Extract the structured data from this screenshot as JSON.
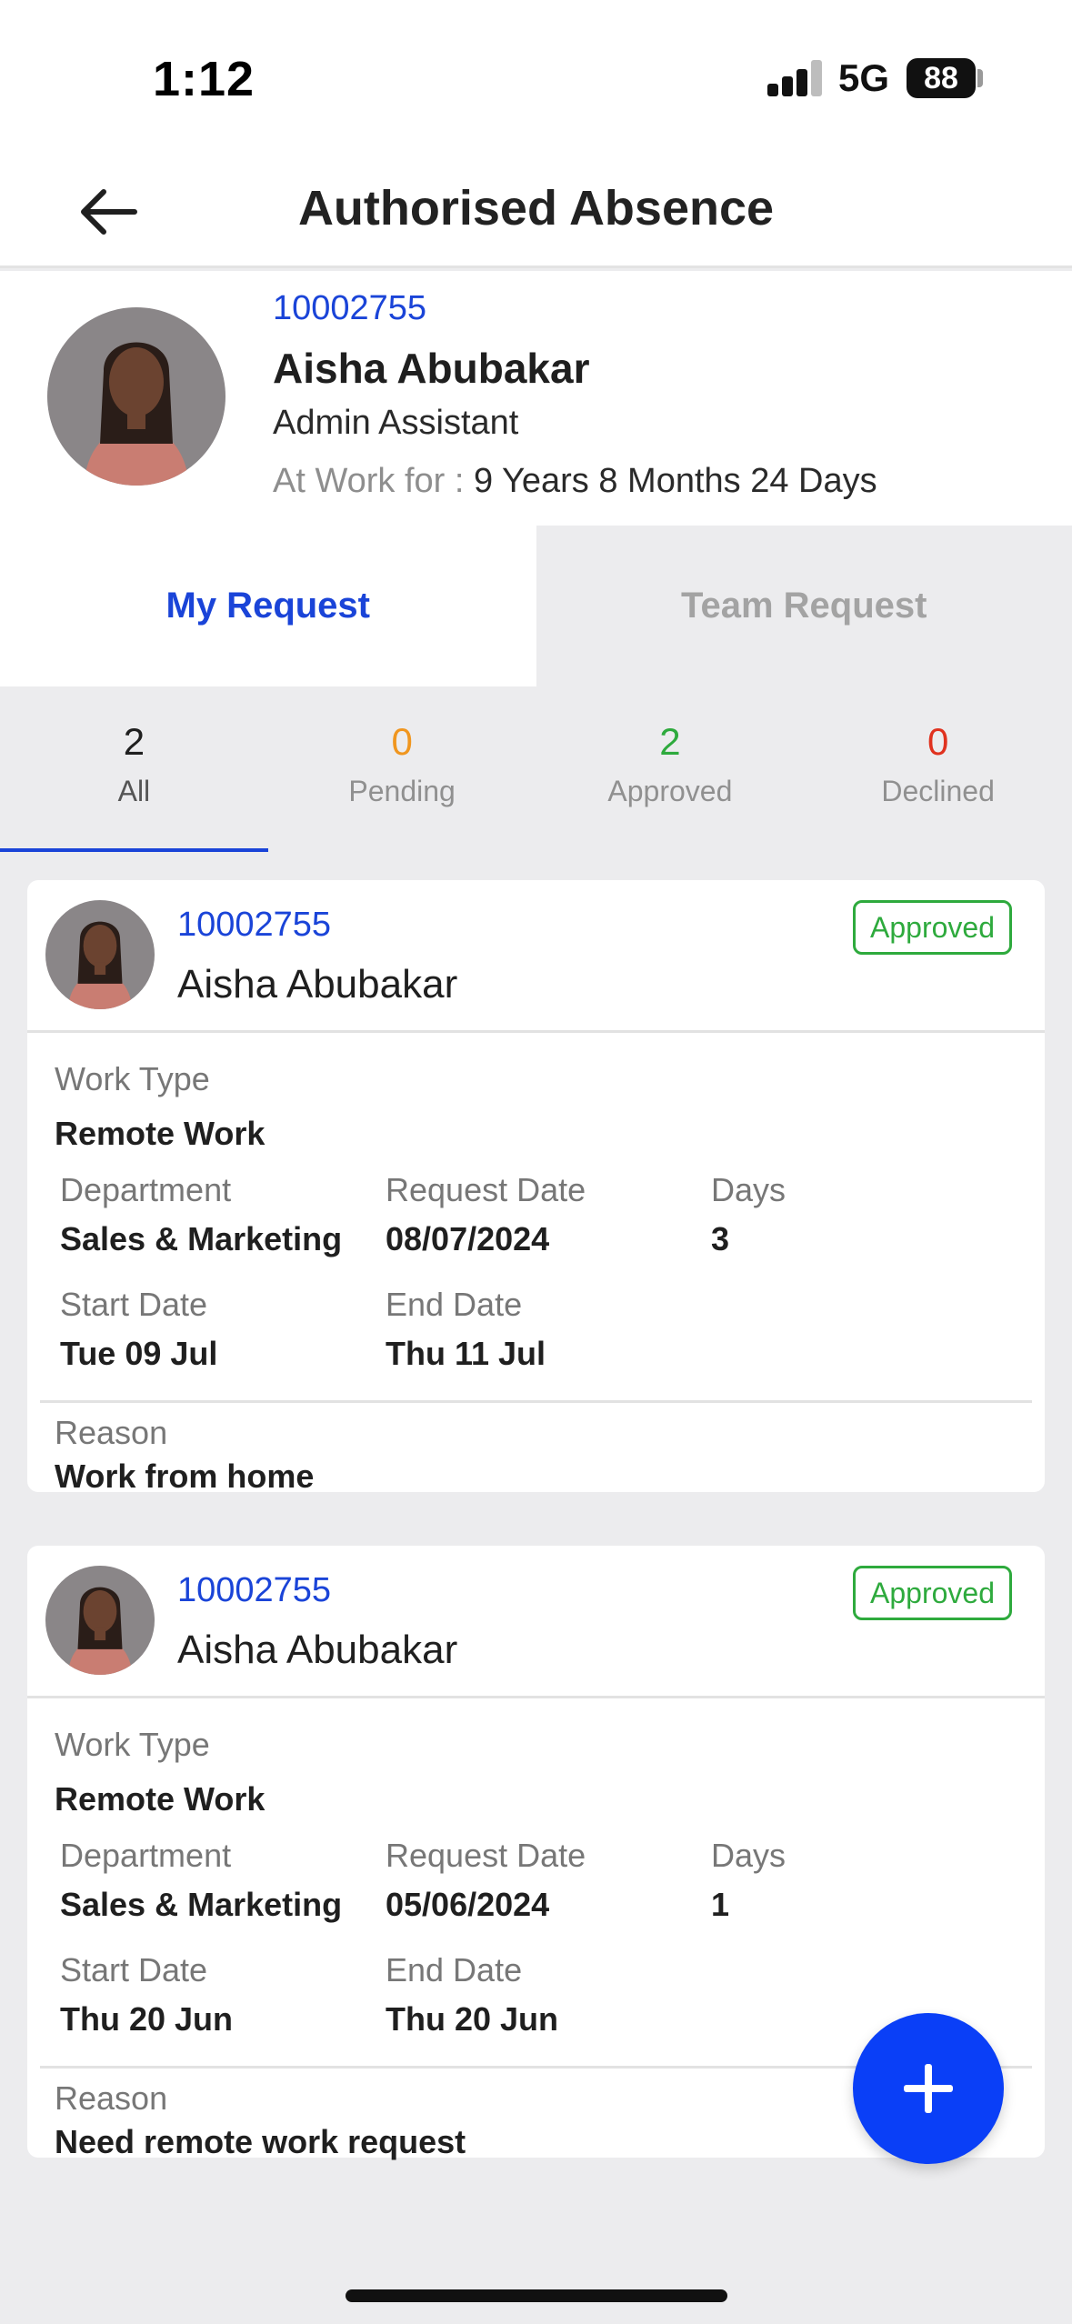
{
  "status_bar": {
    "time": "1:12",
    "network": "5G",
    "battery": "88"
  },
  "header": {
    "title": "Authorised Absence",
    "back_icon": "arrow-left-icon"
  },
  "profile": {
    "employee_id": "10002755",
    "name": "Aisha Abubakar",
    "role": "Admin Assistant",
    "tenure_label": "At Work for : ",
    "tenure_value": "9 Years 8 Months 24 Days"
  },
  "tabs": [
    {
      "label": "My Request",
      "active": true
    },
    {
      "label": "Team Request",
      "active": false
    }
  ],
  "filters": [
    {
      "count": "2",
      "label": "All",
      "color": "#1f1f1f"
    },
    {
      "count": "0",
      "label": "Pending",
      "color": "#f0961f"
    },
    {
      "count": "2",
      "label": "Approved",
      "color": "#2eaa3d"
    },
    {
      "count": "0",
      "label": "Declined",
      "color": "#e0321f"
    }
  ],
  "labels": {
    "work_type": "Work Type",
    "department": "Department",
    "request_date": "Request Date",
    "days": "Days",
    "start_date": "Start Date",
    "end_date": "End Date",
    "reason": "Reason"
  },
  "requests": [
    {
      "employee_id": "10002755",
      "name": "Aisha Abubakar",
      "status": "Approved",
      "work_type": "Remote Work",
      "department": "Sales & Marketing",
      "request_date": "08/07/2024",
      "days": "3",
      "start_date": "Tue 09 Jul",
      "end_date": "Thu 11 Jul",
      "reason": "Work from home"
    },
    {
      "employee_id": "10002755",
      "name": "Aisha Abubakar",
      "status": "Approved",
      "work_type": "Remote Work",
      "department": "Sales & Marketing",
      "request_date": "05/06/2024",
      "days": "1",
      "start_date": "Thu 20 Jun",
      "end_date": "Thu 20 Jun",
      "reason": "Need remote work request"
    }
  ],
  "fab_icon": "plus-icon"
}
